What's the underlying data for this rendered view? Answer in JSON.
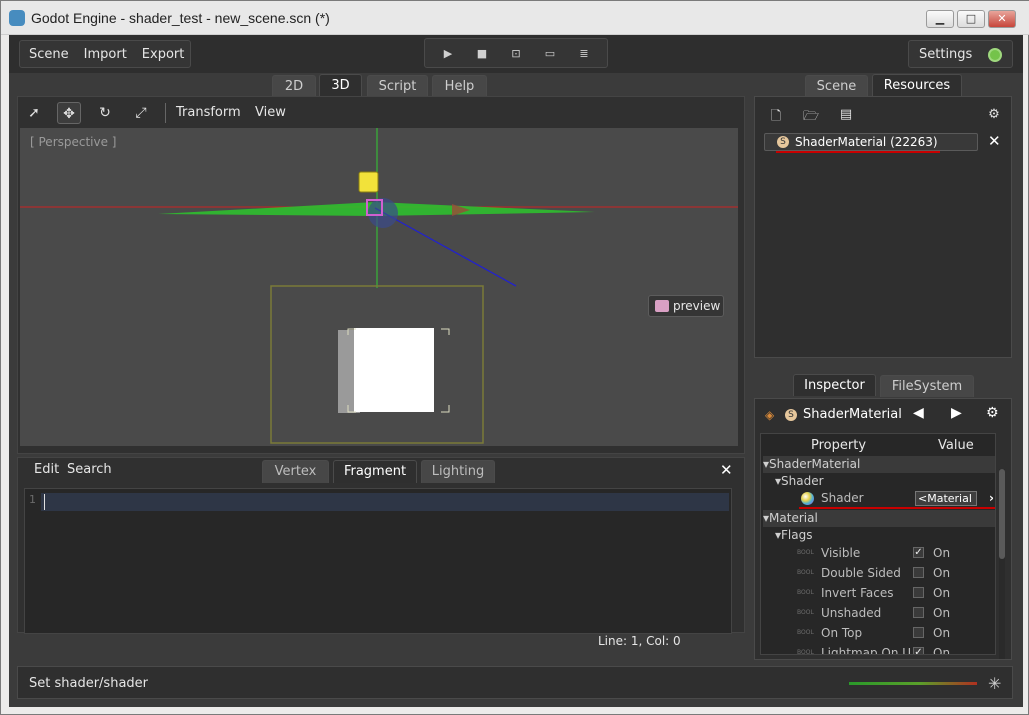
{
  "window": {
    "title": "Godot Engine - shader_test - new_scene.scn (*)",
    "min": "▁",
    "max": "□",
    "close": "✕"
  },
  "menu": {
    "scene": "Scene",
    "import": "Import",
    "export": "Export"
  },
  "play": {
    "play": "▶",
    "stop": "■",
    "play_scene": "⊡",
    "play_custom": "▭",
    "debug": "≣"
  },
  "settings": {
    "label": "Settings"
  },
  "main_tabs": [
    "2D",
    "3D",
    "Script",
    "Help"
  ],
  "main_tabs_active": "3D",
  "viewport": {
    "transform": "Transform",
    "view": "View",
    "perspective": "[ Perspective ]",
    "preview": "preview"
  },
  "shader_editor": {
    "edit": "Edit",
    "search": "Search",
    "tabs": [
      "Vertex",
      "Fragment",
      "Lighting"
    ],
    "active_tab": "Fragment",
    "line_number": "1",
    "status": "Line: 1, Col: 0",
    "close": "✕"
  },
  "right_tabs": [
    "Scene",
    "Resources"
  ],
  "right_tabs_active": "Resources",
  "resources": {
    "item": "ShaderMaterial (22263)",
    "item_icon": "S",
    "close": "✕"
  },
  "lower_tabs": [
    "Inspector",
    "FileSystem"
  ],
  "lower_tabs_active": "Inspector",
  "inspector": {
    "title": "ShaderMaterial",
    "icon": "S",
    "col_property": "Property",
    "col_value": "Value",
    "section_shadermaterial": "ShaderMaterial",
    "section_shader": "Shader",
    "shader_label": "Shader",
    "shader_value": "<Material",
    "section_material": "Material",
    "section_flags": "Flags",
    "bool_tag": "BOOL",
    "flags": [
      {
        "name": "Visible",
        "checked": "✓",
        "value": "On"
      },
      {
        "name": "Double Sided",
        "checked": "",
        "value": "On"
      },
      {
        "name": "Invert Faces",
        "checked": "",
        "value": "On"
      },
      {
        "name": "Unshaded",
        "checked": "",
        "value": "On"
      },
      {
        "name": "On Top",
        "checked": "",
        "value": "On"
      },
      {
        "name": "Lightmap On U",
        "checked": "✓",
        "value": "On"
      }
    ]
  },
  "statusbar": {
    "text": "Set shader/shader"
  },
  "colors": {
    "accent_red": "#c80000",
    "ok_green": "#74c34a",
    "grid_green": "#33cc33",
    "axis_red": "#cc2222",
    "axis_blue": "#2222cc"
  }
}
